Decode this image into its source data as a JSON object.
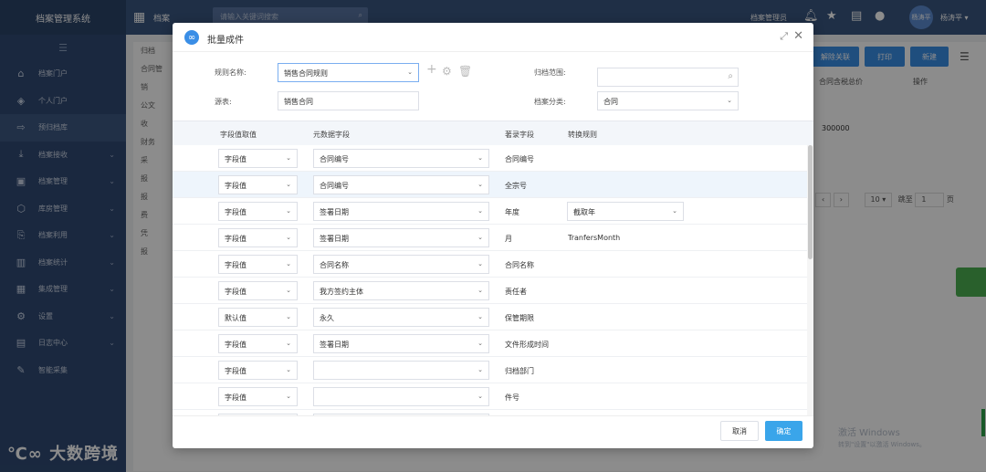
{
  "app": {
    "brand": "档案管理系统",
    "logo_text": "大数跨境"
  },
  "sidebar": {
    "collapse_icon": "menu-collapse-icon",
    "items": [
      {
        "label": "档案门户",
        "icon": "home-icon",
        "has_children": false
      },
      {
        "label": "个人门户",
        "icon": "layers-icon",
        "has_children": false
      },
      {
        "label": "预归档库",
        "icon": "arrow-right-icon",
        "has_children": false,
        "active": true
      },
      {
        "label": "档案接收",
        "icon": "download-icon",
        "has_children": true
      },
      {
        "label": "档案管理",
        "icon": "save-icon",
        "has_children": true
      },
      {
        "label": "库房管理",
        "icon": "warehouse-icon",
        "has_children": true
      },
      {
        "label": "档案利用",
        "icon": "search-doc-icon",
        "has_children": true
      },
      {
        "label": "档案统计",
        "icon": "bar-chart-icon",
        "has_children": true
      },
      {
        "label": "集成管理",
        "icon": "grid-icon",
        "has_children": true
      },
      {
        "label": "设置",
        "icon": "gear-icon",
        "has_children": true
      },
      {
        "label": "日志中心",
        "icon": "log-icon",
        "has_children": true
      },
      {
        "label": "智能采集",
        "icon": "edit-icon",
        "has_children": false
      }
    ]
  },
  "topbar": {
    "title": "档案",
    "search_placeholder": "请输入关键词搜索",
    "role": "档案管理员",
    "avatar_text": "杨涛平",
    "username": "杨涛平"
  },
  "background": {
    "tree": [
      "归档",
      "合同管",
      "销",
      "公文",
      "收",
      "财务",
      "采",
      "报",
      "报",
      "费",
      "凭",
      "报"
    ],
    "buttons": [
      "解除关联",
      "打印",
      "新建"
    ],
    "columns": [
      "合同含税总价",
      "操作"
    ],
    "value": "300000",
    "pager": {
      "size": "10",
      "goto_label": "跳至",
      "page": "1",
      "page_suffix": "页"
    }
  },
  "watermark": {
    "title": "激活 Windows",
    "sub": "转到\"设置\"以激活 Windows。"
  },
  "modal": {
    "title": "批量成件",
    "rule_name_label": "规则名称:",
    "rule_name_value": "销售合同规则",
    "source_label": "源表:",
    "source_value": "销售合同",
    "scope_label": "归档范围:",
    "scope_value": "",
    "category_label": "档案分类:",
    "category_value": "合同",
    "columns": {
      "field_value": "字段值取值",
      "metadata": "元数据字段",
      "catalog": "著录字段",
      "convert": "转换规则"
    },
    "rows": [
      {
        "mode": "字段值",
        "meta": "合同编号",
        "catalog": "合同编号",
        "rule": "",
        "rule_type": "none"
      },
      {
        "mode": "字段值",
        "meta": "合同编号",
        "catalog": "全宗号",
        "rule": "",
        "rule_type": "none",
        "highlight": true
      },
      {
        "mode": "字段值",
        "meta": "签署日期",
        "catalog": "年度",
        "rule": "截取年",
        "rule_type": "select"
      },
      {
        "mode": "字段值",
        "meta": "签署日期",
        "catalog": "月",
        "rule": "TranfersMonth",
        "rule_type": "text"
      },
      {
        "mode": "字段值",
        "meta": "合同名称",
        "catalog": "合同名称",
        "rule": "",
        "rule_type": "none"
      },
      {
        "mode": "字段值",
        "meta": "我方签约主体",
        "catalog": "责任者",
        "rule": "",
        "rule_type": "none"
      },
      {
        "mode": "默认值",
        "meta": "永久",
        "catalog": "保管期限",
        "rule": "",
        "rule_type": "none"
      },
      {
        "mode": "字段值",
        "meta": "签署日期",
        "catalog": "文件形成时间",
        "rule": "",
        "rule_type": "none"
      },
      {
        "mode": "字段值",
        "meta": "",
        "catalog": "归档部门",
        "rule": "",
        "rule_type": "none"
      },
      {
        "mode": "字段值",
        "meta": "",
        "catalog": "件号",
        "rule": "",
        "rule_type": "none"
      },
      {
        "mode": "",
        "meta": "",
        "catalog": "",
        "rule": "",
        "rule_type": "none"
      }
    ],
    "cancel_label": "取消",
    "ok_label": "确定"
  }
}
